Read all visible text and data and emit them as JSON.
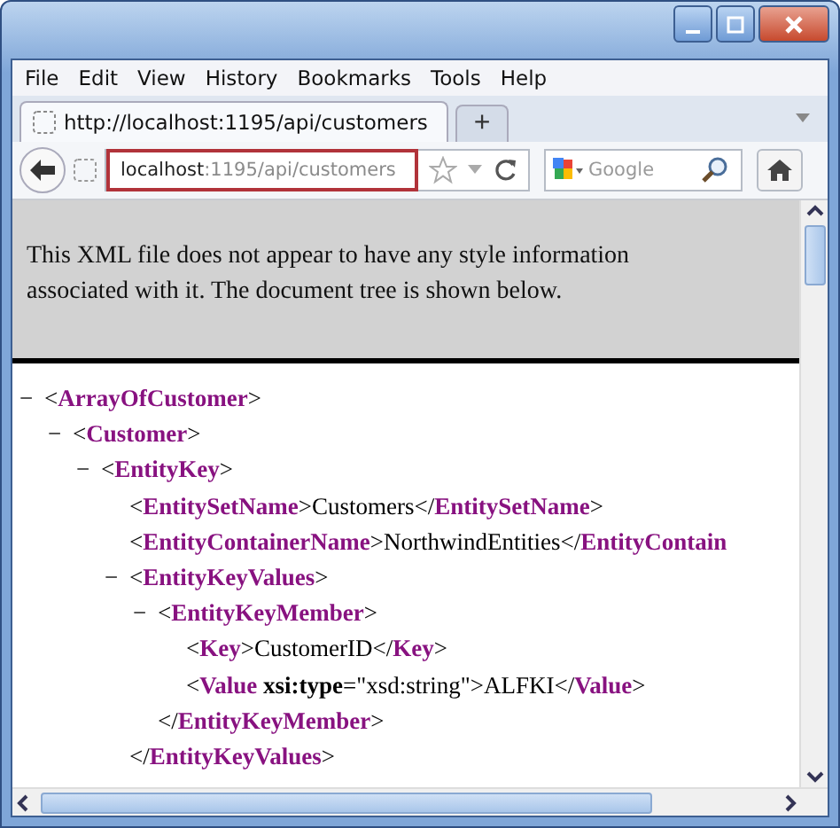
{
  "menu": [
    {
      "label": "File"
    },
    {
      "label": "Edit"
    },
    {
      "label": "View"
    },
    {
      "label": "History"
    },
    {
      "label": "Bookmarks"
    },
    {
      "label": "Tools"
    },
    {
      "label": "Help"
    }
  ],
  "tabs": [
    {
      "label": "http://localhost:1195/api/customers",
      "selected": true
    }
  ],
  "new_tab": "+",
  "address": {
    "host": "localhost",
    "path": ":1195/api/customers",
    "highlighted": true
  },
  "search": {
    "placeholder": "Google"
  },
  "notice": "This XML file does not appear to have any style information associated with it. The document tree is shown below.",
  "tree": [
    {
      "toggle": "−",
      "line": [
        {
          "kind": "punct",
          "text": "<"
        },
        {
          "kind": "tag",
          "text": "ArrayOfCustomer"
        },
        {
          "kind": "punct",
          "text": ">"
        }
      ],
      "children": [
        {
          "toggle": "−",
          "line": [
            {
              "kind": "punct",
              "text": "<"
            },
            {
              "kind": "tag",
              "text": "Customer"
            },
            {
              "kind": "punct",
              "text": ">"
            }
          ],
          "children": [
            {
              "toggle": "−",
              "line": [
                {
                  "kind": "punct",
                  "text": "<"
                },
                {
                  "kind": "tag",
                  "text": "EntityKey"
                },
                {
                  "kind": "punct",
                  "text": ">"
                }
              ],
              "children": [
                {
                  "line": [
                    {
                      "kind": "punct",
                      "text": "<"
                    },
                    {
                      "kind": "tag",
                      "text": "EntitySetName"
                    },
                    {
                      "kind": "punct",
                      "text": ">"
                    },
                    {
                      "kind": "text",
                      "text": "Customers"
                    },
                    {
                      "kind": "punct",
                      "text": "</"
                    },
                    {
                      "kind": "tag",
                      "text": "EntitySetName"
                    },
                    {
                      "kind": "punct",
                      "text": ">"
                    }
                  ]
                },
                {
                  "line": [
                    {
                      "kind": "punct",
                      "text": "<"
                    },
                    {
                      "kind": "tag",
                      "text": "EntityContainerName"
                    },
                    {
                      "kind": "punct",
                      "text": ">"
                    },
                    {
                      "kind": "text",
                      "text": "NorthwindEntities"
                    },
                    {
                      "kind": "punct",
                      "text": "</"
                    },
                    {
                      "kind": "tag",
                      "text": "EntityContain"
                    }
                  ]
                },
                {
                  "toggle": "−",
                  "line": [
                    {
                      "kind": "punct",
                      "text": "<"
                    },
                    {
                      "kind": "tag",
                      "text": "EntityKeyValues"
                    },
                    {
                      "kind": "punct",
                      "text": ">"
                    }
                  ],
                  "children": [
                    {
                      "toggle": "−",
                      "line": [
                        {
                          "kind": "punct",
                          "text": "<"
                        },
                        {
                          "kind": "tag",
                          "text": "EntityKeyMember"
                        },
                        {
                          "kind": "punct",
                          "text": ">"
                        }
                      ],
                      "children": [
                        {
                          "line": [
                            {
                              "kind": "punct",
                              "text": "<"
                            },
                            {
                              "kind": "tag",
                              "text": "Key"
                            },
                            {
                              "kind": "punct",
                              "text": ">"
                            },
                            {
                              "kind": "text",
                              "text": "CustomerID"
                            },
                            {
                              "kind": "punct",
                              "text": "</"
                            },
                            {
                              "kind": "tag",
                              "text": "Key"
                            },
                            {
                              "kind": "punct",
                              "text": ">"
                            }
                          ]
                        },
                        {
                          "line": [
                            {
                              "kind": "punct",
                              "text": "<"
                            },
                            {
                              "kind": "tag",
                              "text": "Value"
                            },
                            {
                              "kind": "attr",
                              "text": " xsi:type"
                            },
                            {
                              "kind": "punct",
                              "text": "=\""
                            },
                            {
                              "kind": "text",
                              "text": "xsd:string"
                            },
                            {
                              "kind": "punct",
                              "text": "\">"
                            },
                            {
                              "kind": "text",
                              "text": "ALFKI"
                            },
                            {
                              "kind": "punct",
                              "text": "</"
                            },
                            {
                              "kind": "tag",
                              "text": "Value"
                            },
                            {
                              "kind": "punct",
                              "text": ">"
                            }
                          ]
                        }
                      ],
                      "close": [
                        {
                          "kind": "punct",
                          "text": "</"
                        },
                        {
                          "kind": "tag",
                          "text": "EntityKeyMember"
                        },
                        {
                          "kind": "punct",
                          "text": ">"
                        }
                      ]
                    }
                  ],
                  "close": [
                    {
                      "kind": "punct",
                      "text": "</"
                    },
                    {
                      "kind": "tag",
                      "text": "EntityKeyValues"
                    },
                    {
                      "kind": "punct",
                      "text": ">"
                    }
                  ]
                }
              ]
            }
          ]
        }
      ]
    }
  ]
}
